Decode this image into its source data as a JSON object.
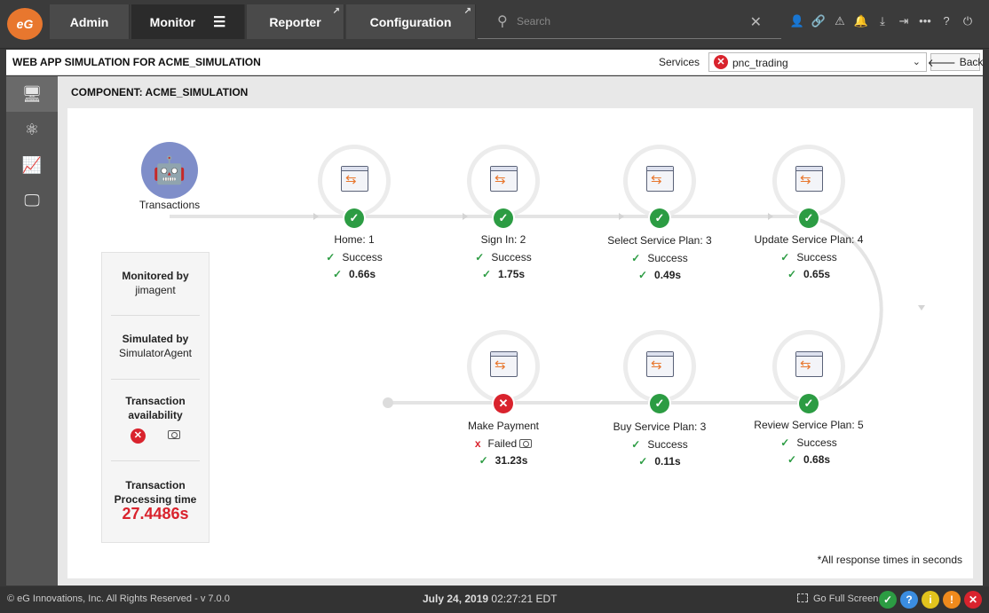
{
  "nav": {
    "logo": "eG",
    "tabs": [
      {
        "label": "Admin"
      },
      {
        "label": "Monitor"
      },
      {
        "label": "Reporter"
      },
      {
        "label": "Configuration"
      }
    ],
    "search_placeholder": "Search"
  },
  "header": {
    "title": "WEB APP SIMULATION FOR ACME_SIMULATION",
    "services_label": "Services",
    "service_value": "pnc_trading",
    "back_label": "Back"
  },
  "main": {
    "component_title": "COMPONENT: ACME_SIMULATION",
    "start_label": "Transactions",
    "note": "*All response times in seconds",
    "steps": [
      {
        "name": "Home: 1",
        "status": "Success",
        "time": "0.66s",
        "ok": true
      },
      {
        "name": "Sign In: 2",
        "status": "Success",
        "time": "1.75s",
        "ok": true
      },
      {
        "name": "Select Service Plan: 3",
        "status": "Success",
        "time": "0.49s",
        "ok": true
      },
      {
        "name": "Update Service Plan: 4",
        "status": "Success",
        "time": "0.65s",
        "ok": true
      },
      {
        "name": "Review Service Plan: 5",
        "status": "Success",
        "time": "0.68s",
        "ok": true
      },
      {
        "name": "Buy Service Plan: 3",
        "status": "Success",
        "time": "0.11s",
        "ok": true
      },
      {
        "name": "Make Payment",
        "status": "Failed",
        "time": "31.23s",
        "ok": false
      }
    ]
  },
  "card": {
    "monitored_label": "Monitored by",
    "monitored_value": "jimagent",
    "simulated_label": "Simulated by",
    "simulated_value": "SimulatorAgent",
    "availability_label_1": "Transaction",
    "availability_label_2": "availability",
    "processing_label_1": "Transaction",
    "processing_label_2": "Processing time",
    "processing_value": "27.4486s"
  },
  "footer": {
    "copyright": "© eG Innovations, Inc. All Rights Reserved - v 7.0.0",
    "date": "July 24, 2019",
    "time": "02:27:21 EDT",
    "fullscreen": "Go Full Screen"
  },
  "colors": {
    "success": "#2c9c43",
    "error": "#d9232d",
    "accent": "#e8772e",
    "robot": "#7f8ec9"
  }
}
